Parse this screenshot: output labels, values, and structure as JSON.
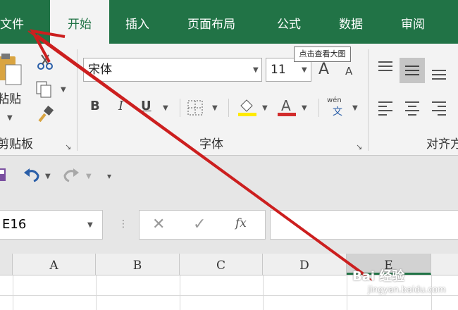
{
  "tabs": [
    {
      "id": "file",
      "label": "文件"
    },
    {
      "id": "home",
      "label": "开始"
    },
    {
      "id": "insert",
      "label": "插入"
    },
    {
      "id": "layout",
      "label": "页面布局"
    },
    {
      "id": "formulas",
      "label": "公式"
    },
    {
      "id": "data",
      "label": "数据"
    },
    {
      "id": "review",
      "label": "审阅"
    }
  ],
  "ribbon": {
    "clipboard": {
      "paste_label": "粘贴",
      "group_label": "剪贴板"
    },
    "font": {
      "font_name": "宋体",
      "font_size": "11",
      "group_label": "字体",
      "bold": "B",
      "italic": "I",
      "underline": "U",
      "phonetic_top": "wén",
      "phonetic_bottom": "文"
    },
    "alignment": {
      "group_label": "对齐方"
    }
  },
  "tooltip": "点击查看大图",
  "formula_bar": {
    "name_box": "E16",
    "fx": "fx"
  },
  "columns": [
    "A",
    "B",
    "C",
    "D",
    "E"
  ],
  "watermark": {
    "line1": "Bai 经验",
    "line2": "jingyan.baidu.com"
  },
  "colors": {
    "accent": "#217346",
    "arrow": "#cc1f1f"
  }
}
